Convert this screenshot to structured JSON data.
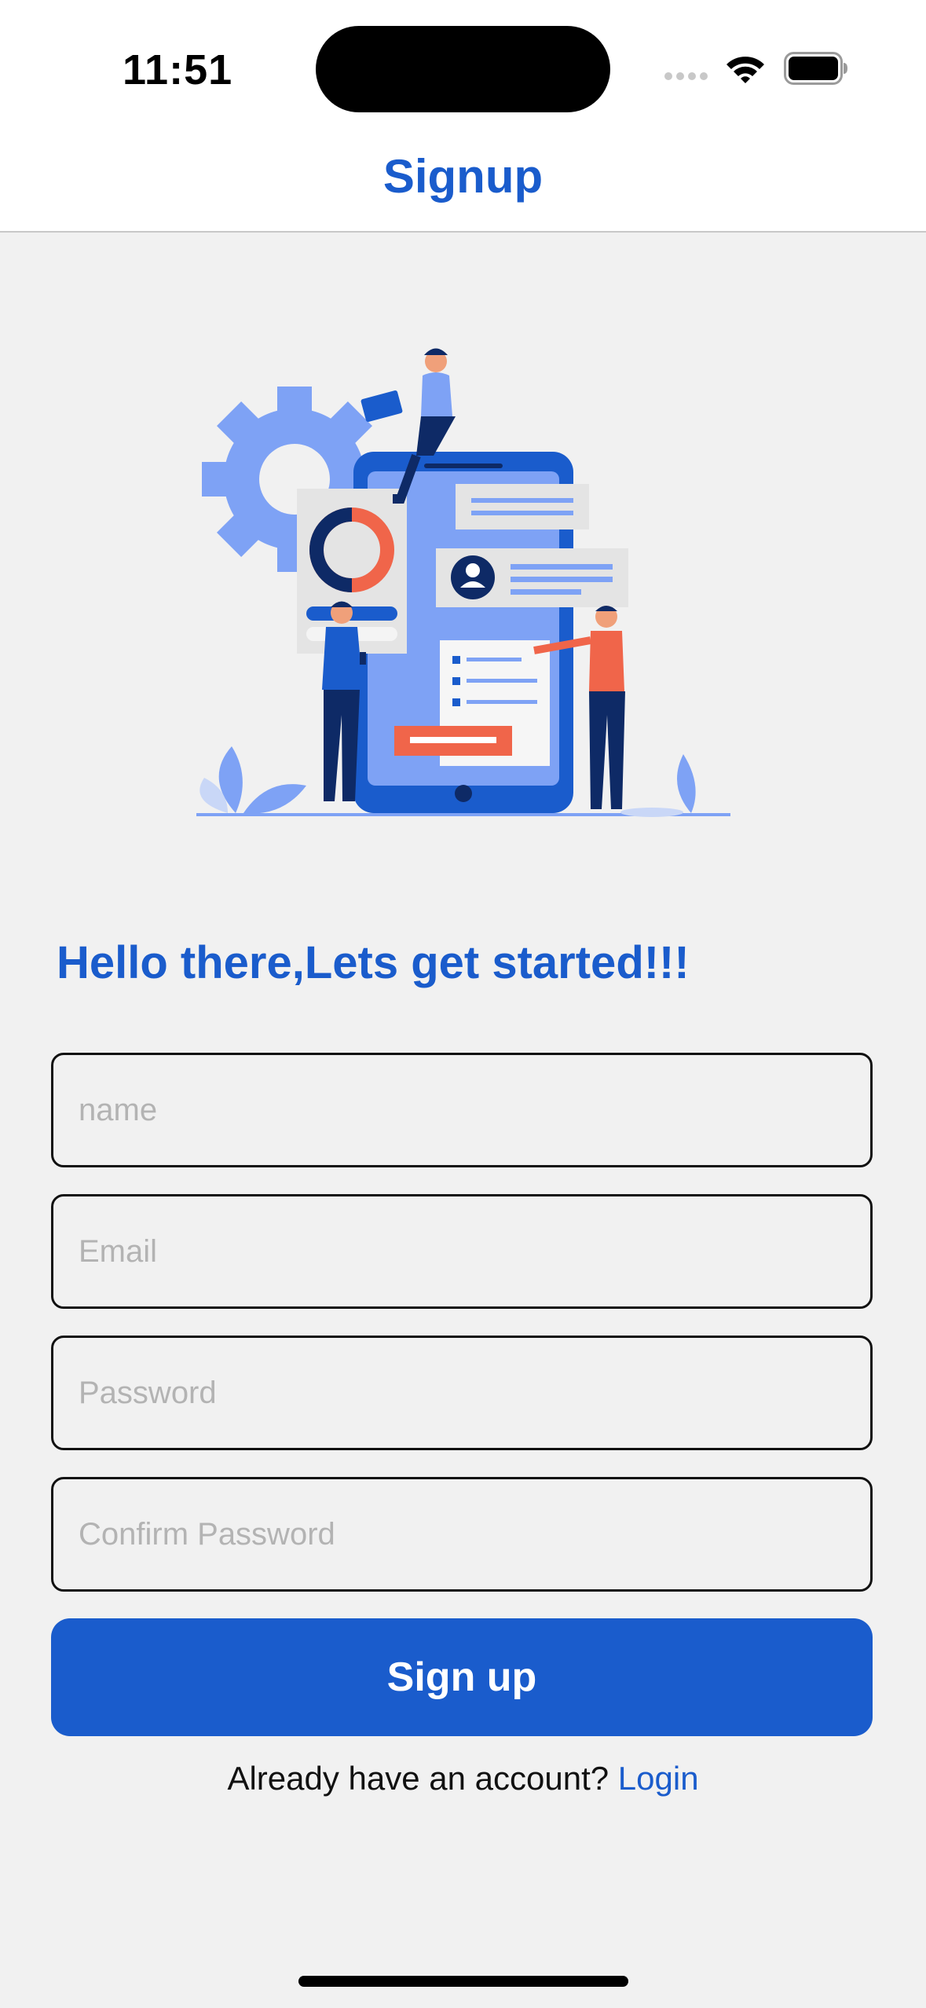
{
  "status_bar": {
    "time": "11:51"
  },
  "nav": {
    "title": "Signup"
  },
  "greeting": "Hello there,Lets get started!!!",
  "form": {
    "name_placeholder": "name",
    "email_placeholder": "Email",
    "password_placeholder": "Password",
    "confirm_placeholder": "Confirm Password",
    "submit_label": "Sign up"
  },
  "footer": {
    "prompt": "Already have an account? ",
    "login_label": "Login"
  },
  "colors": {
    "accent": "#1a5ccc",
    "background": "#f1f1f1",
    "illustration_orange": "#f0654a",
    "illustration_light_blue": "#7ea2f5"
  },
  "icons": [
    "signal-icon",
    "wifi-icon",
    "battery-icon",
    "signup-illustration"
  ]
}
